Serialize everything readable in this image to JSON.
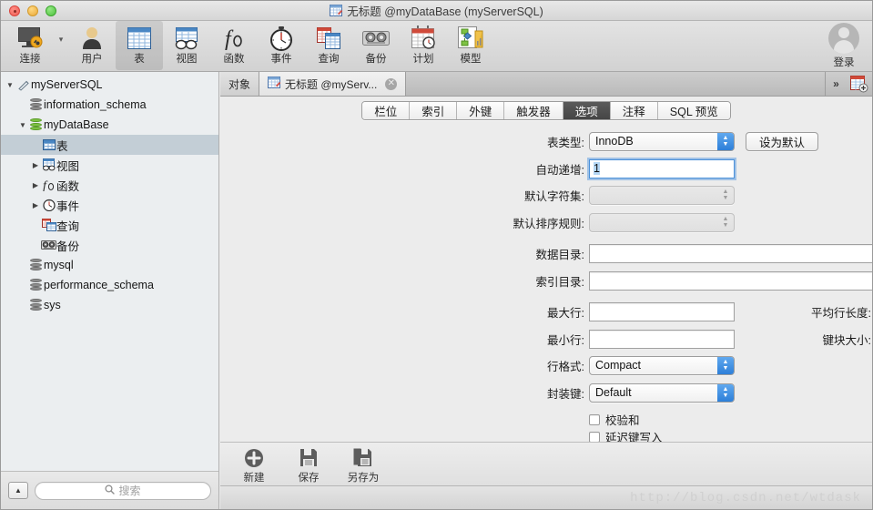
{
  "window": {
    "title": "无标题 @myDataBase (myServerSQL)",
    "title_icon": "table-doc-icon"
  },
  "toolbar": {
    "items": [
      {
        "label": "连接",
        "icon": "connect-icon"
      },
      {
        "label": "用户",
        "icon": "user-icon"
      },
      {
        "label": "表",
        "icon": "table-icon"
      },
      {
        "label": "视图",
        "icon": "view-icon"
      },
      {
        "label": "函数",
        "icon": "function-icon"
      },
      {
        "label": "事件",
        "icon": "event-icon"
      },
      {
        "label": "查询",
        "icon": "query-icon"
      },
      {
        "label": "备份",
        "icon": "backup-icon"
      },
      {
        "label": "计划",
        "icon": "schedule-icon"
      },
      {
        "label": "模型",
        "icon": "model-icon"
      }
    ],
    "selected": "表",
    "account": {
      "label": "登录",
      "icon": "avatar-icon"
    }
  },
  "sidebar": {
    "tree": [
      {
        "label": "myServerSQL",
        "depth": 0,
        "arrow": "down",
        "icon": "server-icon",
        "selected": false
      },
      {
        "label": "information_schema",
        "depth": 1,
        "arrow": "none",
        "icon": "database-icon",
        "selected": false
      },
      {
        "label": "myDataBase",
        "depth": 1,
        "arrow": "down",
        "icon": "database-green-icon",
        "selected": false
      },
      {
        "label": "表",
        "depth": 2,
        "arrow": "none",
        "icon": "table-icon",
        "selected": true
      },
      {
        "label": "视图",
        "depth": 2,
        "arrow": "right",
        "icon": "view-icon",
        "selected": false
      },
      {
        "label": "函数",
        "depth": 2,
        "arrow": "right",
        "icon": "function-icon",
        "selected": false
      },
      {
        "label": "事件",
        "depth": 2,
        "arrow": "right",
        "icon": "event-icon",
        "selected": false
      },
      {
        "label": "查询",
        "depth": 2,
        "arrow": "none",
        "icon": "query-icon",
        "selected": false
      },
      {
        "label": "备份",
        "depth": 2,
        "arrow": "none",
        "icon": "backup-icon",
        "selected": false
      },
      {
        "label": "mysql",
        "depth": 1,
        "arrow": "none",
        "icon": "database-icon",
        "selected": false
      },
      {
        "label": "performance_schema",
        "depth": 1,
        "arrow": "none",
        "icon": "database-icon",
        "selected": false
      },
      {
        "label": "sys",
        "depth": 1,
        "arrow": "none",
        "icon": "database-icon",
        "selected": false
      }
    ],
    "collapse_button": "collapse-icon",
    "search": {
      "placeholder": "搜索",
      "value": "",
      "icon": "search-icon"
    }
  },
  "doc_tabs": {
    "objects_label": "对象",
    "active_label": "无标题 @myServ...",
    "active_icon": "table-doc-icon",
    "close_icon": "close-icon",
    "overflow_icon": "chevron-right-double-icon",
    "new_table_icon": "new-table-icon"
  },
  "segments": {
    "items": [
      "栏位",
      "索引",
      "外键",
      "触发器",
      "选项",
      "注释",
      "SQL 预览"
    ],
    "active": "选项"
  },
  "form": {
    "table_type": {
      "label": "表类型:",
      "value": "InnoDB"
    },
    "set_default_button": "设为默认",
    "auto_increment": {
      "label": "自动递增:",
      "value": "1",
      "focused": true
    },
    "default_charset": {
      "label": "默认字符集:",
      "value": "",
      "disabled": true
    },
    "default_collation": {
      "label": "默认排序规则:",
      "value": "",
      "disabled": true
    },
    "data_directory": {
      "label": "数据目录:",
      "value": "",
      "browse": "..."
    },
    "index_directory": {
      "label": "索引目录:",
      "value": "",
      "browse": "..."
    },
    "max_rows": {
      "label": "最大行:",
      "value": ""
    },
    "avg_row_length": {
      "label": "平均行长度:",
      "value": ""
    },
    "min_rows": {
      "label": "最小行:",
      "value": ""
    },
    "key_block_size": {
      "label": "键块大小:",
      "value": ""
    },
    "row_format": {
      "label": "行格式:",
      "value": "Compact"
    },
    "pack_keys": {
      "label": "封装键:",
      "value": "Default"
    },
    "checksum": {
      "label": "校验和",
      "checked": false
    },
    "delay_key_write": {
      "label": "延迟键写入",
      "checked": false
    }
  },
  "bottom_toolbar": {
    "items": [
      {
        "label": "新建",
        "icon": "add-icon"
      },
      {
        "label": "保存",
        "icon": "save-icon"
      },
      {
        "label": "另存为",
        "icon": "save-as-icon"
      }
    ]
  },
  "watermark": "http://blog.csdn.net/wtdask",
  "colors": {
    "accent_blue": "#2d7fd8",
    "selection_blue": "#b4d7f6",
    "tree_selection": "#c3ced6",
    "segment_active": "#454545"
  }
}
